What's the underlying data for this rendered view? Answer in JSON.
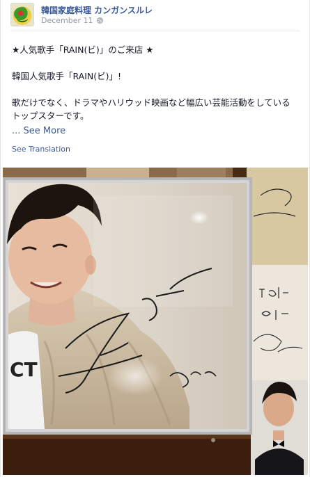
{
  "post": {
    "page_name": "韓国家庭料理  カンガンスルレ",
    "date": "December 11",
    "lines": [
      "★人気歌手「RAIN(ビ)」のご来店 ★",
      "",
      "韓国人気歌手「RAIN(ビ)」!",
      "",
      "歌だけでなく、ドラマやハリウッド映画など幅広い芸能活動をしている",
      "トップスターです。"
    ],
    "ellipsis": "...",
    "see_more": "See More",
    "see_translation": "See Translation"
  },
  "icons": {
    "avatar": "restaurant-logo-avatar",
    "privacy": "globe-icon"
  },
  "colors": {
    "link": "#3b5998",
    "meta": "#9197a3",
    "text": "#141823"
  }
}
